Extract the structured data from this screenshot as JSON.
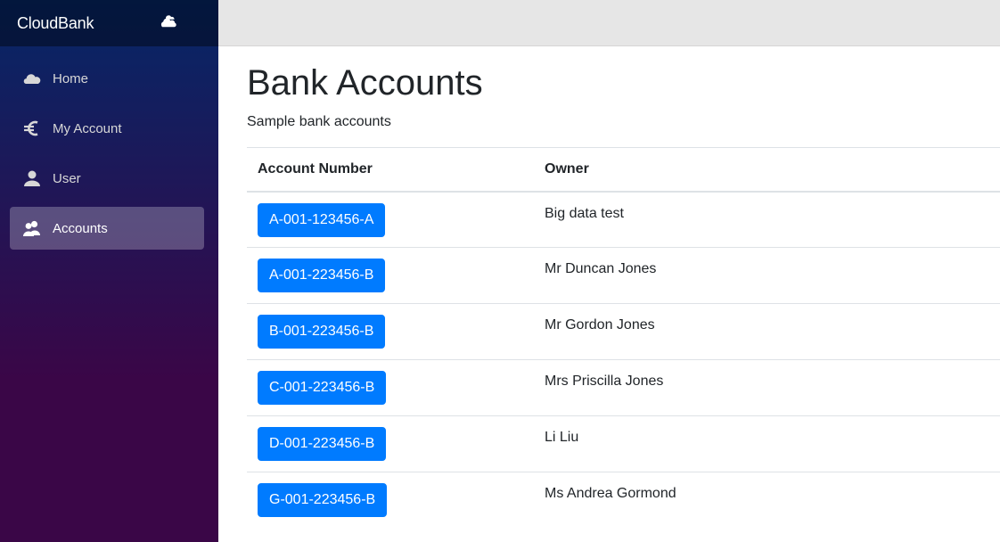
{
  "brand": {
    "name": "CloudBank",
    "icon": "clouds-icon"
  },
  "sidebar": {
    "items": [
      {
        "label": "Home",
        "icon": "cloud-icon",
        "active": false
      },
      {
        "label": "My Account",
        "icon": "euro-icon",
        "active": false
      },
      {
        "label": "User",
        "icon": "person-icon",
        "active": false
      },
      {
        "label": "Accounts",
        "icon": "people-icon",
        "active": true
      }
    ]
  },
  "page": {
    "title": "Bank Accounts",
    "subtitle": "Sample bank accounts"
  },
  "table": {
    "columns": [
      "Account Number",
      "Owner"
    ],
    "rows": [
      {
        "account": "A-001-123456-A",
        "owner": "Big data test"
      },
      {
        "account": "A-001-223456-B",
        "owner": "Mr Duncan Jones"
      },
      {
        "account": "B-001-223456-B",
        "owner": "Mr Gordon Jones"
      },
      {
        "account": "C-001-223456-B",
        "owner": "Mrs Priscilla Jones"
      },
      {
        "account": "D-001-223456-B",
        "owner": "Li Liu"
      },
      {
        "account": "G-001-223456-B",
        "owner": "Ms Andrea Gormond"
      }
    ]
  },
  "colors": {
    "primary": "#007bff",
    "sidebar_top": "#052767",
    "sidebar_bottom": "#3a0647",
    "top_row": "#e6e6e6"
  }
}
